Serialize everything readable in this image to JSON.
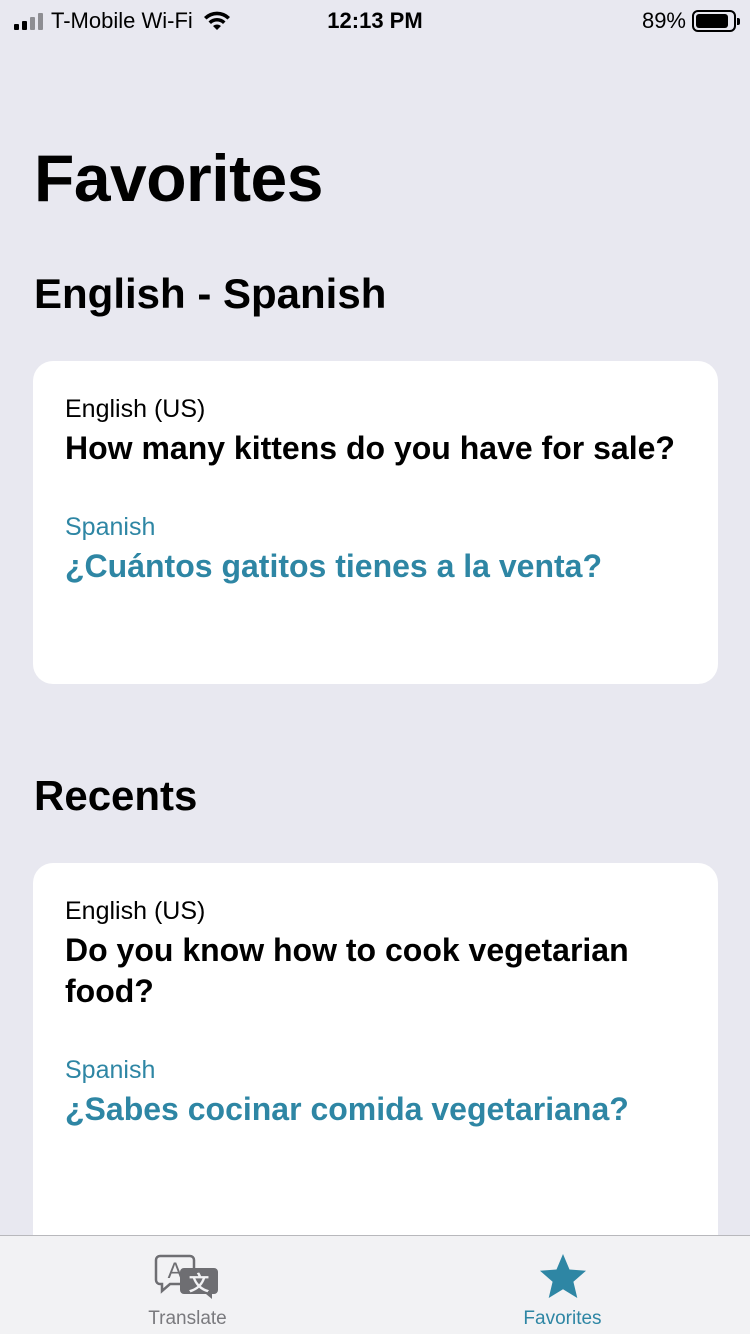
{
  "status_bar": {
    "carrier": "T-Mobile Wi-Fi",
    "time": "12:13 PM",
    "battery_percent": "89%",
    "battery_level": 0.89,
    "signal_bars": 2
  },
  "page_title": "Favorites",
  "favorites": {
    "section_title": "English - Spanish",
    "items": [
      {
        "source_lang": "English (US)",
        "source_text": "How many kittens do you have for sale?",
        "target_lang": "Spanish",
        "target_text": "¿Cuántos gatitos tienes a la venta?"
      }
    ]
  },
  "recents": {
    "section_title": "Recents",
    "items": [
      {
        "source_lang": "English (US)",
        "source_text": "Do you know how to cook vegetarian food?",
        "target_lang": "Spanish",
        "target_text": "¿Sabes cocinar comida vegetariana?"
      }
    ]
  },
  "tab_bar": {
    "tabs": [
      {
        "label": "Translate",
        "icon": "translate-icon",
        "active": false
      },
      {
        "label": "Favorites",
        "icon": "star-icon",
        "active": true
      }
    ]
  },
  "colors": {
    "accent": "#2e86a4",
    "background": "#e8e8f0",
    "card": "#ffffff"
  }
}
